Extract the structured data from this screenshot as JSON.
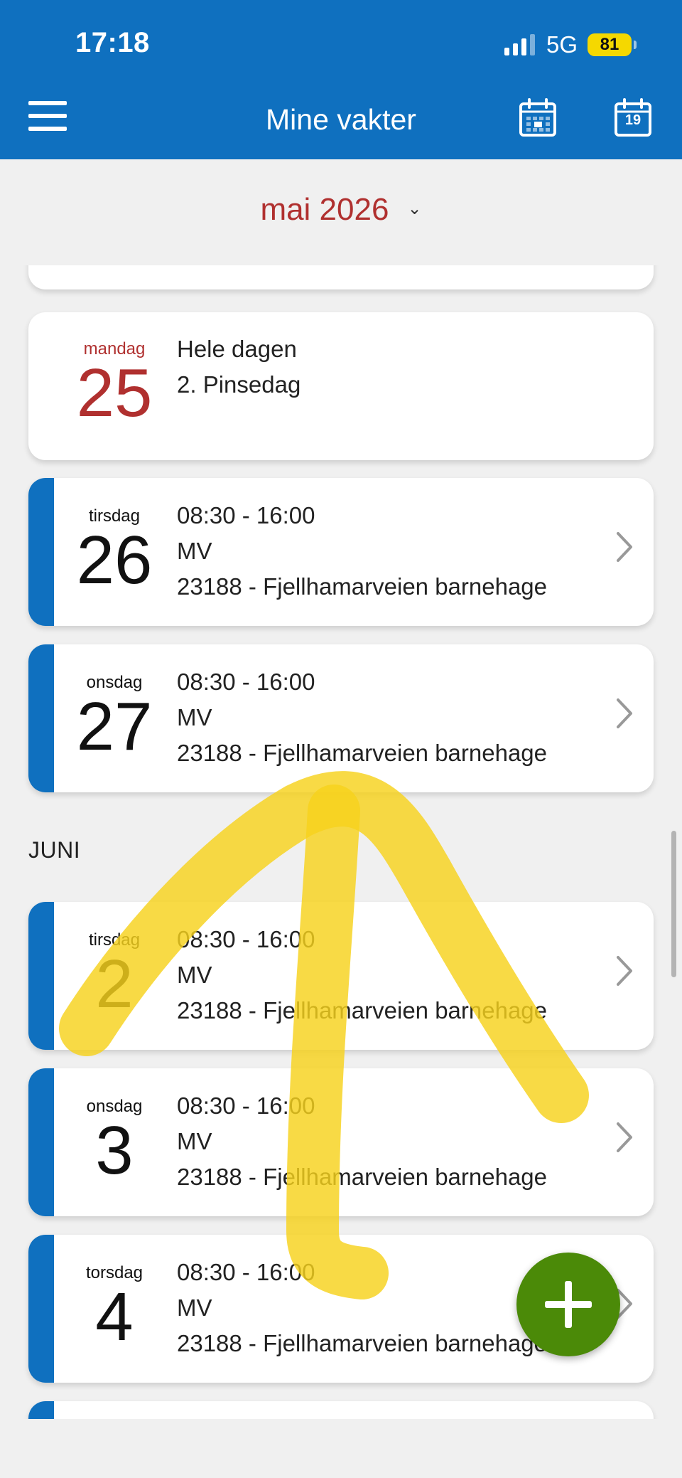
{
  "status_bar": {
    "time": "17:18",
    "network": "5G",
    "battery": "81"
  },
  "header": {
    "title": "Mine vakter",
    "menu_icon": "hamburger-menu-icon",
    "calendar_month_icon": "calendar-month-icon",
    "calendar_day_icon": "calendar-today-icon",
    "calendar_day_number": "19",
    "color": "#0f70bf"
  },
  "month_selector": {
    "label": "mai 2026",
    "chevron": "⌄",
    "color": "#b0302f"
  },
  "shifts": [
    {
      "weekday": "mandag",
      "day": "25",
      "line1": "Hele dagen",
      "line2": "2. Pinsedag",
      "line3": "",
      "holiday": true
    },
    {
      "weekday": "tirsdag",
      "day": "26",
      "line1": "08:30 - 16:00",
      "line2": "MV",
      "line3": "23188 - Fjellhamarveien barnehage",
      "holiday": false
    },
    {
      "weekday": "onsdag",
      "day": "27",
      "line1": "08:30 - 16:00",
      "line2": "MV",
      "line3": "23188 - Fjellhamarveien barnehage",
      "holiday": false
    }
  ],
  "section_june": "JUNI",
  "june_shifts": [
    {
      "weekday": "tirsdag",
      "day": "2",
      "line1": "08:30 - 16:00",
      "line2": "MV",
      "line3": "23188 - Fjellhamarveien barnehage"
    },
    {
      "weekday": "onsdag",
      "day": "3",
      "line1": "08:30 - 16:00",
      "line2": "MV",
      "line3": "23188 - Fjellhamarveien barnehage"
    },
    {
      "weekday": "torsdag",
      "day": "4",
      "line1": "08:30 - 16:00",
      "line2": "MV",
      "line3": "23188 - Fjellhamarveien barnehage"
    }
  ],
  "fab": {
    "icon": "plus-icon",
    "color": "#4b8a08"
  },
  "annotation": {
    "color": "#f7d21c",
    "shape": "hand-drawn upward arrow"
  }
}
